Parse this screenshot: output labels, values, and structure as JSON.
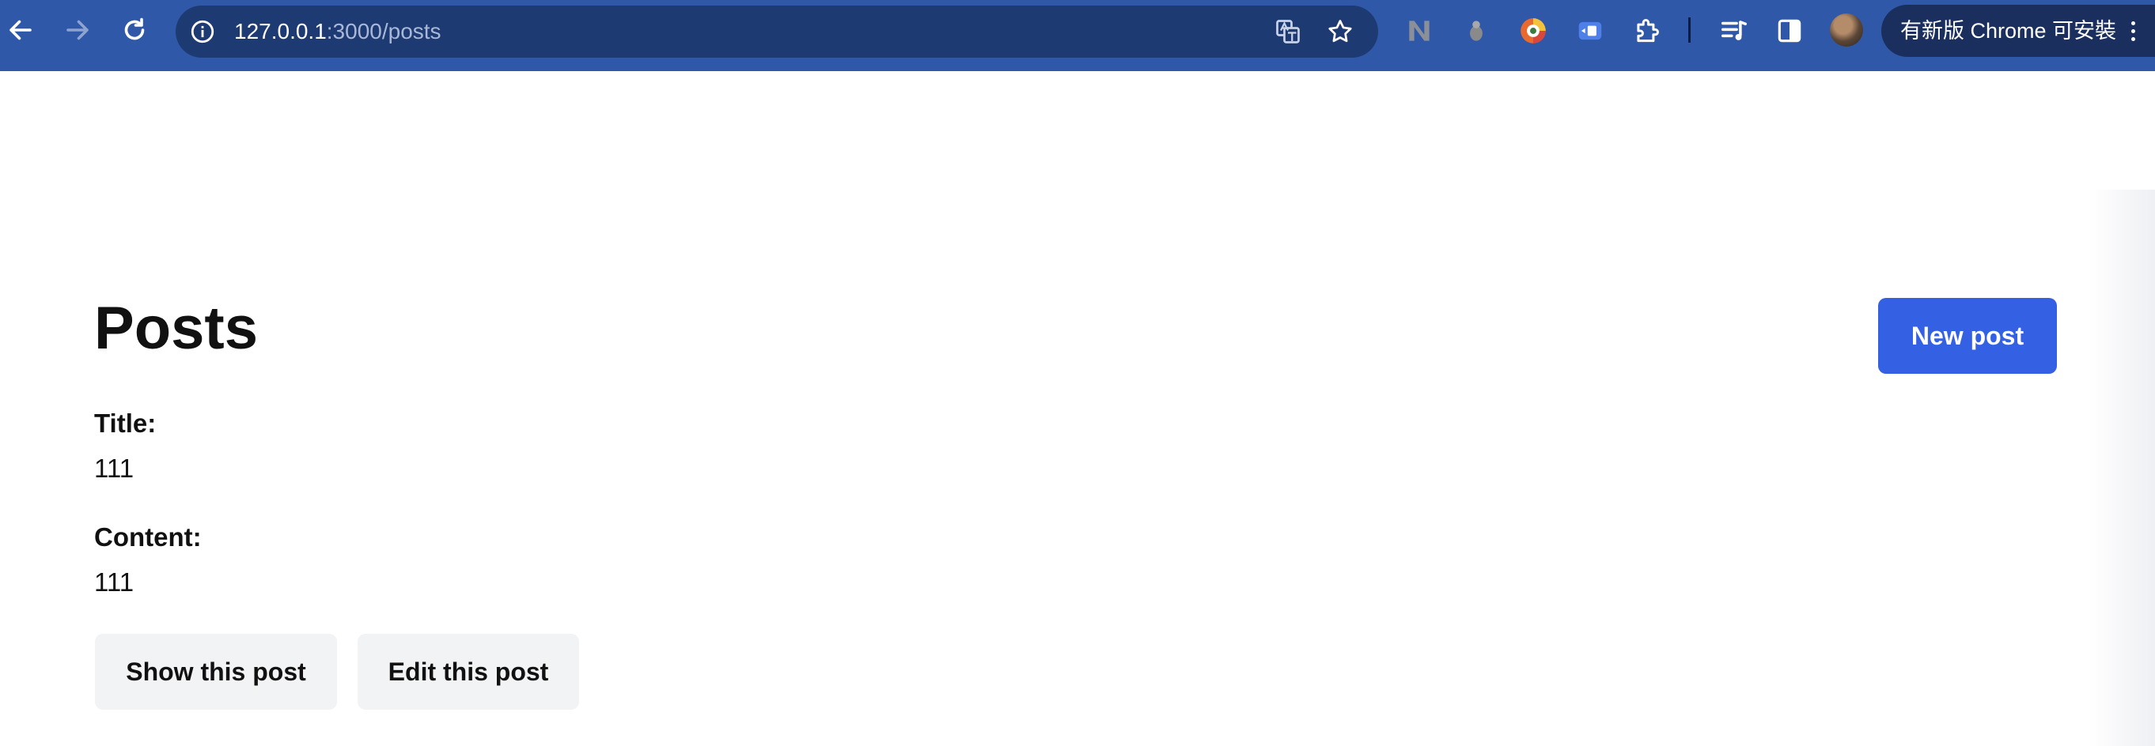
{
  "browser": {
    "url_host": "127.0.0.1",
    "url_path": ":3000/posts",
    "update_label": "有新版 Chrome 可安裝",
    "icons": [
      "back-arrow-icon",
      "forward-arrow-icon",
      "reload-icon",
      "info-icon",
      "translate-icon",
      "star-icon",
      "extension-icon",
      "puzzle-icon",
      "media-queue-icon",
      "side-panel-icon",
      "kebab-menu-icon"
    ],
    "colors": {
      "toolbar": "#2f58a8",
      "omnibox": "#1e3a73"
    }
  },
  "page": {
    "title": "Posts",
    "new_post_label": "New post",
    "post": {
      "title_label": "Title:",
      "title_value": "111",
      "content_label": "Content:",
      "content_value": "111"
    },
    "actions": {
      "show_label": "Show this post",
      "edit_label": "Edit this post"
    },
    "colors": {
      "primary": "#3461e3",
      "secondary_button": "#f2f3f5"
    }
  }
}
